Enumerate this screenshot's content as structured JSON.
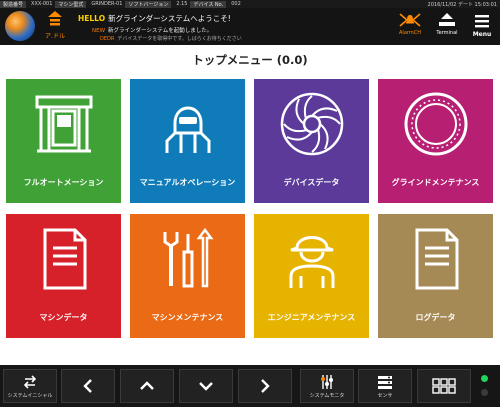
{
  "status_strip": {
    "items": [
      "製造番号",
      "XXX-001",
      "マシン型式",
      "GRINDER-01",
      "ソフトバージョン",
      "2.15",
      "デバイス No.",
      "002"
    ],
    "datetime": "2016/11/02 デート 15:03:01"
  },
  "header": {
    "home_label": "ア.ドル",
    "messages": [
      {
        "tag": "HELLO",
        "text": "新グラインダーシステムへようこそ!"
      },
      {
        "tag": "NEW",
        "text": "新グラインダーシステムを起動しました。"
      },
      {
        "tag": "DEDR",
        "text": "デバイスデータを取得中です。しばらくお待ちください"
      }
    ],
    "alarm_label": "AlarmCH",
    "terminal_label": "Terminal",
    "menu_label": "Menu"
  },
  "page_title": "トップメニュー (0.0)",
  "tiles": [
    {
      "label": "フルオートメーション",
      "color": "#3fa136",
      "icon": "machine-door-icon"
    },
    {
      "label": "マニュアルオペレーション",
      "color": "#0f7bb9",
      "icon": "welder-mask-icon"
    },
    {
      "label": "デバイスデータ",
      "color": "#5b3a9a",
      "icon": "turbine-icon"
    },
    {
      "label": "グラインドメンテナンス",
      "color": "#b71f73",
      "icon": "grinding-wheel-icon"
    },
    {
      "label": "マシンデータ",
      "color": "#d6212a",
      "icon": "document-icon"
    },
    {
      "label": "マシンメンテナンス",
      "color": "#ea6a15",
      "icon": "wrench-screwdriver-icon"
    },
    {
      "label": "エンジニアメンテナンス",
      "color": "#e6b300",
      "icon": "engineer-icon"
    },
    {
      "label": "ログデータ",
      "color": "#a68a55",
      "icon": "log-document-icon"
    }
  ],
  "bottom_bar": {
    "system_init_label": "システムイニシャル",
    "system_monitor_label": "システムモニタ",
    "sensor_label": "センサ"
  },
  "colors": {
    "accent": "#ff8a00",
    "status_ok": "#21d45a"
  }
}
